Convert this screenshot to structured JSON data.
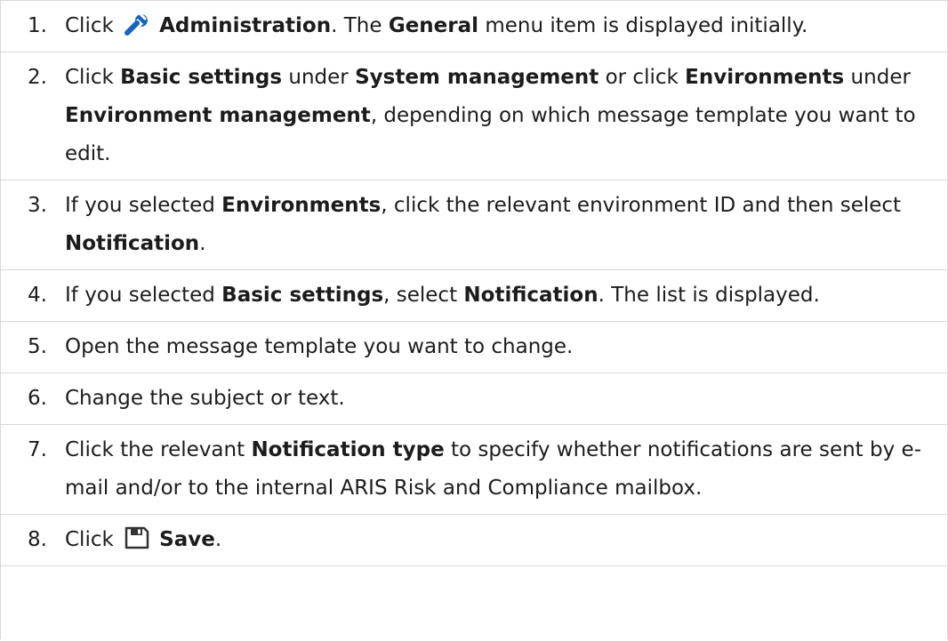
{
  "steps": [
    {
      "num": "1.",
      "parts": [
        {
          "t": "Click "
        },
        {
          "icon": "wrench-icon"
        },
        {
          "t": "Administration",
          "b": true
        },
        {
          "t": ". The "
        },
        {
          "t": "General",
          "b": true
        },
        {
          "t": " menu item is displayed initially."
        }
      ]
    },
    {
      "num": "2.",
      "parts": [
        {
          "t": "Click "
        },
        {
          "t": "Basic settings",
          "b": true
        },
        {
          "t": " under "
        },
        {
          "t": "System management",
          "b": true
        },
        {
          "t": " or click "
        },
        {
          "t": "Environments",
          "b": true
        },
        {
          "t": " under "
        },
        {
          "t": "Environment management",
          "b": true
        },
        {
          "t": ", depending on which message template you want to edit."
        }
      ]
    },
    {
      "num": "3.",
      "parts": [
        {
          "t": "If you selected "
        },
        {
          "t": "Environments",
          "b": true
        },
        {
          "t": ", click the relevant environment ID and then select "
        },
        {
          "t": "Notification",
          "b": true
        },
        {
          "t": "."
        }
      ]
    },
    {
      "num": "4.",
      "parts": [
        {
          "t": "If you selected "
        },
        {
          "t": "Basic settings",
          "b": true
        },
        {
          "t": ", select "
        },
        {
          "t": "Notification",
          "b": true
        },
        {
          "t": ". The list is displayed."
        }
      ]
    },
    {
      "num": "5.",
      "parts": [
        {
          "t": "Open the message template you want to change."
        }
      ]
    },
    {
      "num": "6.",
      "parts": [
        {
          "t": "Change the subject or text."
        }
      ]
    },
    {
      "num": "7.",
      "parts": [
        {
          "t": "Click the relevant "
        },
        {
          "t": "Notification type",
          "b": true
        },
        {
          "t": " to specify whether notifications are sent by e-mail and/or to the internal ARIS Risk and Compliance mailbox."
        }
      ]
    },
    {
      "num": "8.",
      "parts": [
        {
          "t": "Click "
        },
        {
          "icon": "save-icon"
        },
        {
          "t": "Save",
          "b": true
        },
        {
          "t": "."
        }
      ]
    }
  ],
  "colors": {
    "wrench_icon": "#1565c0",
    "save_icon": "#333333",
    "divider": "#d9d9d9",
    "text": "#1c1c1c"
  }
}
